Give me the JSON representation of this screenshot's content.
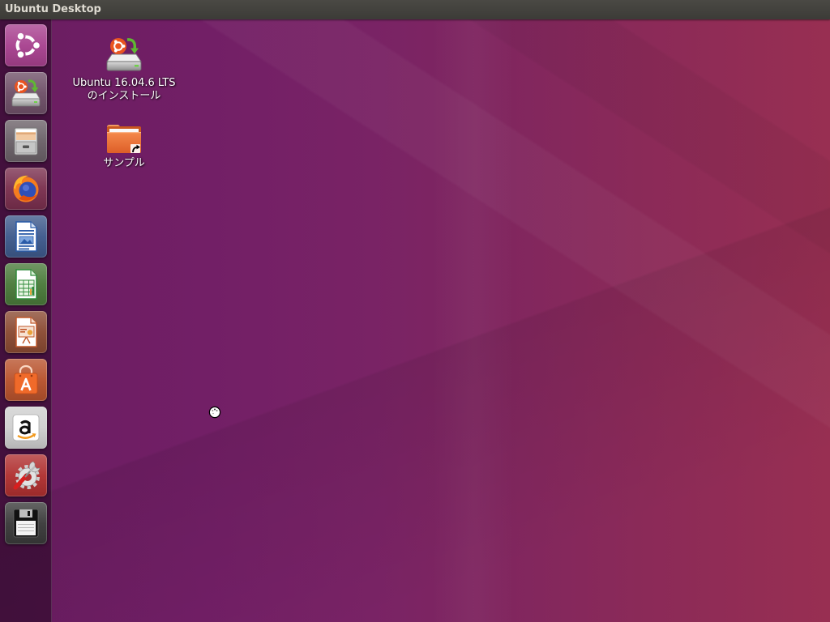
{
  "theme": {
    "panel_background": "#3c3b37",
    "panel_text": "#dfdbd2",
    "label_text": "#ffffff"
  },
  "panel": {
    "title": "Ubuntu Desktop"
  },
  "launcher": {
    "items": [
      {
        "icon": "ubuntu-dash-icon",
        "color": "#a8418f"
      },
      {
        "icon": "ubuntu-installer-icon",
        "color": "#6f5068"
      },
      {
        "icon": "files-icon",
        "color": "#6b6168"
      },
      {
        "icon": "firefox-icon",
        "color": "#7a2f4e"
      },
      {
        "icon": "libreoffice-writer-icon",
        "color": "#3e5a8c"
      },
      {
        "icon": "libreoffice-calc-icon",
        "color": "#4a7a3a"
      },
      {
        "icon": "libreoffice-impress-icon",
        "color": "#8a4a32"
      },
      {
        "icon": "software-center-icon",
        "color": "#b8522c"
      },
      {
        "icon": "amazon-icon",
        "color": "#cfcfcf"
      },
      {
        "icon": "system-settings-icon",
        "color": "#b03030"
      },
      {
        "icon": "floppy-drive-icon",
        "color": "#3a3a3a"
      }
    ]
  },
  "desktop": {
    "icons": [
      {
        "icon": "installer-drive-icon",
        "label_lines": [
          "Ubuntu 16.04.6 LTS",
          "のインストール"
        ]
      },
      {
        "icon": "folder-link-icon",
        "label_lines": [
          "サンプル"
        ]
      }
    ]
  }
}
